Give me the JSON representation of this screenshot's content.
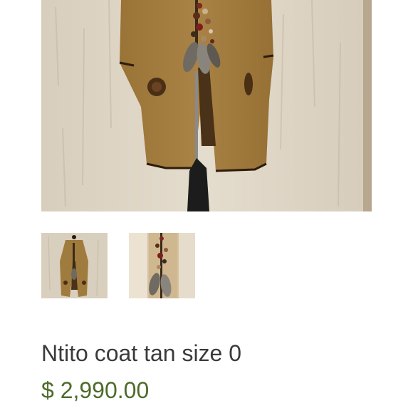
{
  "product": {
    "title": "Ntito coat tan size 0",
    "price": "$ 2,990.00"
  },
  "gallery": {
    "main_image_alt": "Ntito coat tan on mannequin",
    "thumbnails": [
      {
        "alt": "Ntito coat tan full view"
      },
      {
        "alt": "Ntito coat tan beaded necklace detail"
      }
    ]
  },
  "colors": {
    "coat": "#a07b3e",
    "wall": "#ddd3c2",
    "price": "#4d6b2a",
    "title": "#3a3a3a"
  }
}
